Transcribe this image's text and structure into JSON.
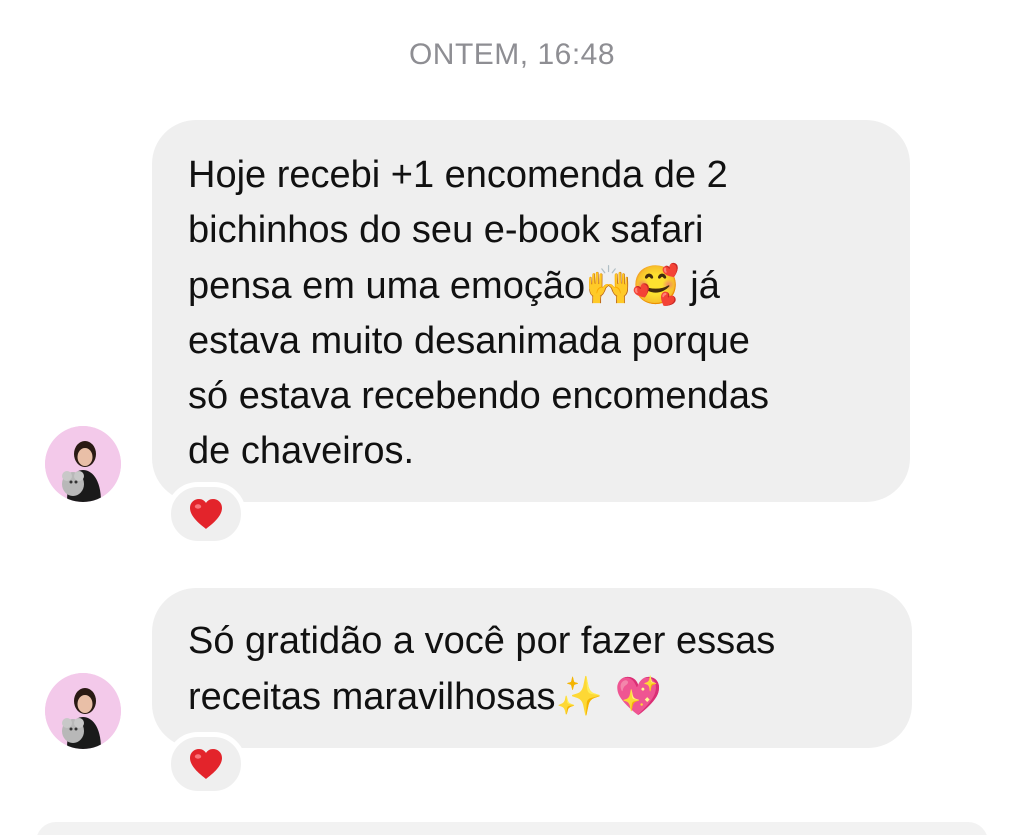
{
  "conversation": {
    "timestamp": "ONTEM, 16:48",
    "messages": [
      {
        "lines": [
          "Hoje recebi +1 encomenda de 2",
          "bichinhos do seu e-book safari",
          "pensa em uma emoção",
          "estava muito desanimada porque",
          "só estava recebendo encomendas",
          "de chaveiros."
        ],
        "line3_emojis": "🙌🥰",
        "line3_tail": " já",
        "reaction": "❤️"
      },
      {
        "lines": [
          "Só gratidão a você por fazer essas",
          "receitas maravilhosas"
        ],
        "line2_emojis": "✨ 💖",
        "reaction": "❤️"
      }
    ]
  },
  "colors": {
    "bubble": "#efefef",
    "timestamp": "#8e8e93",
    "heart": "#e3242b",
    "avatar_bg": "#f3c9ea"
  },
  "icons": {
    "reaction": "heart-icon",
    "avatar": "profile-avatar"
  }
}
